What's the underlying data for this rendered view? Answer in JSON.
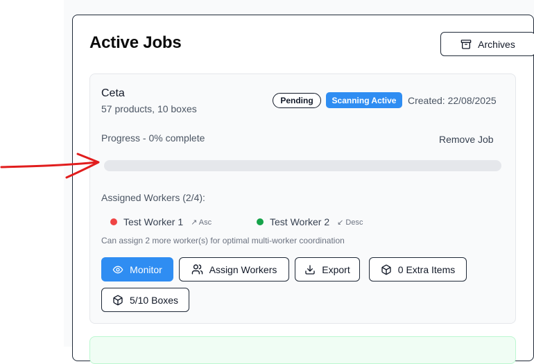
{
  "header": {
    "title": "Active Jobs",
    "archives_label": "Archives"
  },
  "job": {
    "name": "Ceta",
    "summary": "57 products, 10 boxes",
    "status_badge": "Pending",
    "scanning_badge": "Scanning Active",
    "created": "Created: 22/08/2025",
    "progress_label": "Progress - 0% complete",
    "progress_fraction": 0,
    "remove_label": "Remove Job",
    "workers_label": "Assigned Workers (2/4):",
    "workers": [
      {
        "name": "Test Worker 1",
        "direction": "↗ Asc",
        "status_color": "#ef4444"
      },
      {
        "name": "Test Worker 2",
        "direction": "↙ Desc",
        "status_color": "#16a34a"
      }
    ],
    "hint": "Can assign 2 more worker(s) for optimal multi-worker coordination",
    "actions": {
      "monitor": "Monitor",
      "assign": "Assign Workers",
      "export": "Export",
      "extra_items": "0 Extra Items",
      "boxes": "5/10 Boxes"
    }
  },
  "colors": {
    "accent": "#2f8df2",
    "annotation_arrow": "#e11d1d"
  }
}
